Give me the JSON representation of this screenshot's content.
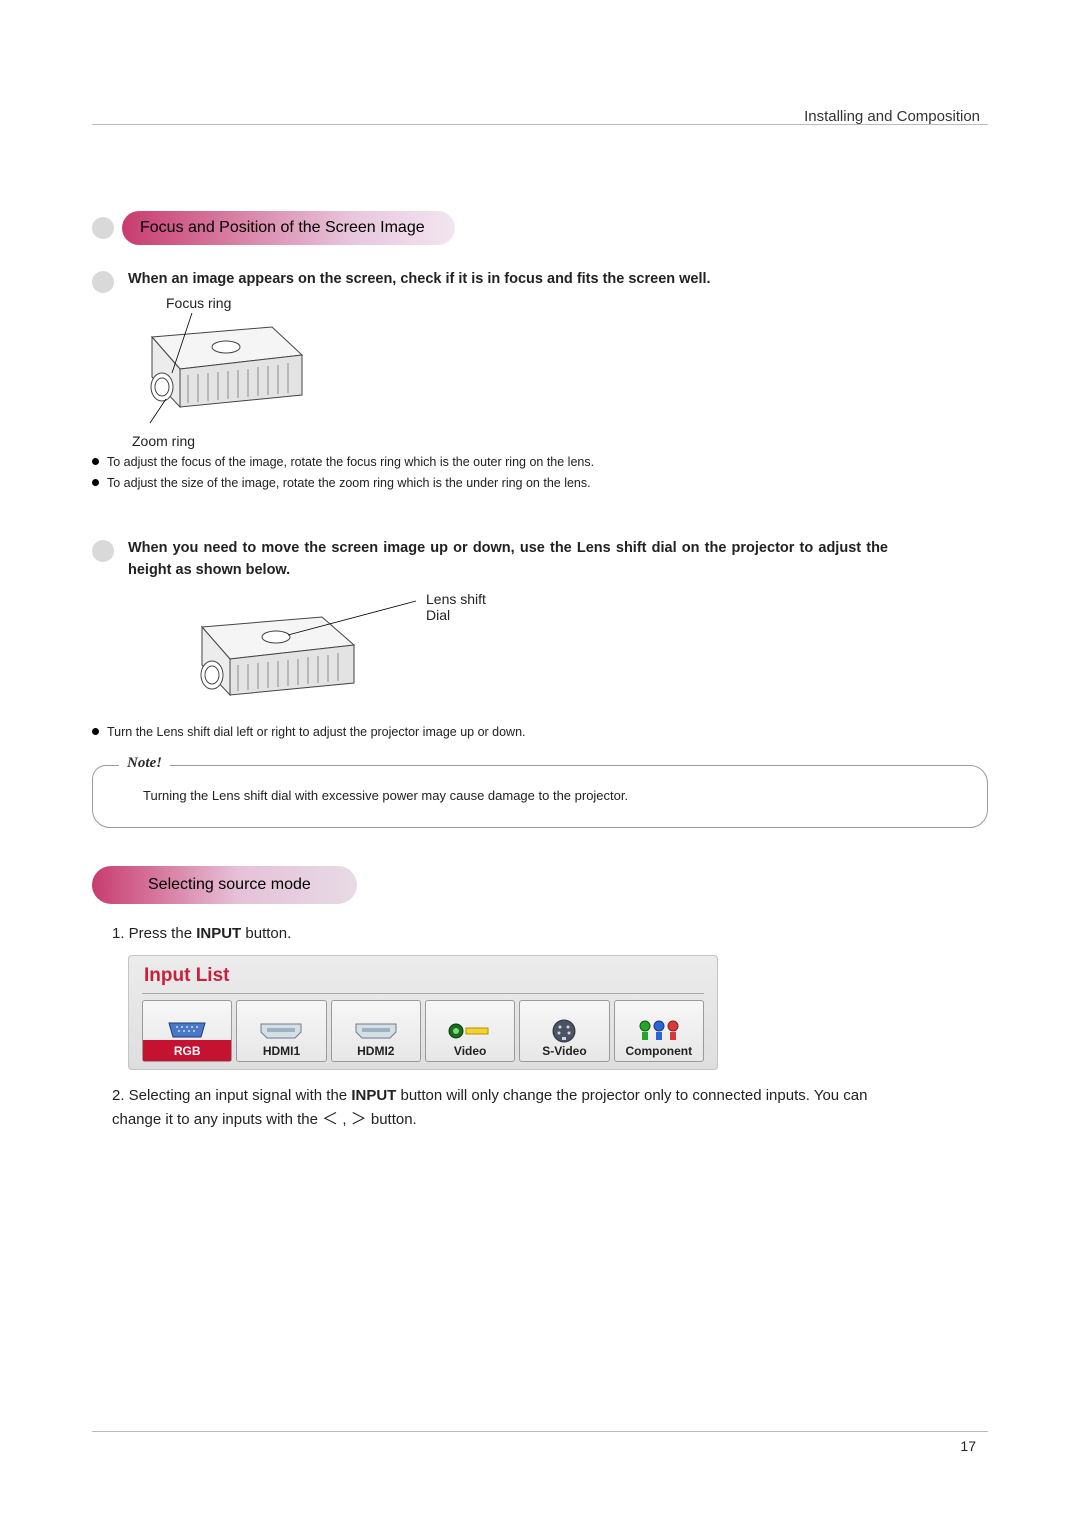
{
  "header_label": "Installing and Composition",
  "pill_focus": "Focus and Position of the Screen Image",
  "pill_source": "Selecting source mode",
  "lead_focus": "When an image appears on the screen, check if it is in focus and fits the screen well.",
  "lead_shift": "When you need to move the screen image up or down, use the Lens shift dial on the projector to adjust the height as shown below.",
  "fig1": {
    "focus_ring": "Focus ring",
    "zoom_ring": "Zoom ring"
  },
  "fig2": {
    "lens_shift": "Lens shift Dial"
  },
  "bullets_focus": [
    "To adjust the focus of the image, rotate the focus ring which is the outer ring on the lens.",
    "To adjust the size of the image, rotate the zoom ring which is the under ring on the lens."
  ],
  "bullet_shift": "Turn the Lens shift dial left or right to adjust the projector image up or down.",
  "note_label": "Note!",
  "note_text": "Turning the Lens shift dial with excessive power may cause damage to the projector.",
  "step1_pre": "1. Press the ",
  "step1_bold": "INPUT",
  "step1_post": " button.",
  "step2_a": "2. Selecting an input signal with the ",
  "step2_bold": "INPUT",
  "step2_b": " button will only change the projector only to connected inputs. You can change it to any inputs with the ",
  "step2_c": " button.",
  "chev_lt": "＜",
  "chev_gt": "＞",
  "chev_sep": " , ",
  "input_panel": {
    "title": "Input List",
    "cells": [
      {
        "label": "RGB",
        "selected": true
      },
      {
        "label": "HDMI1",
        "selected": false
      },
      {
        "label": "HDMI2",
        "selected": false
      },
      {
        "label": "Video",
        "selected": false
      },
      {
        "label": "S-Video",
        "selected": false
      },
      {
        "label": "Component",
        "selected": false
      }
    ]
  },
  "page_number": "17"
}
